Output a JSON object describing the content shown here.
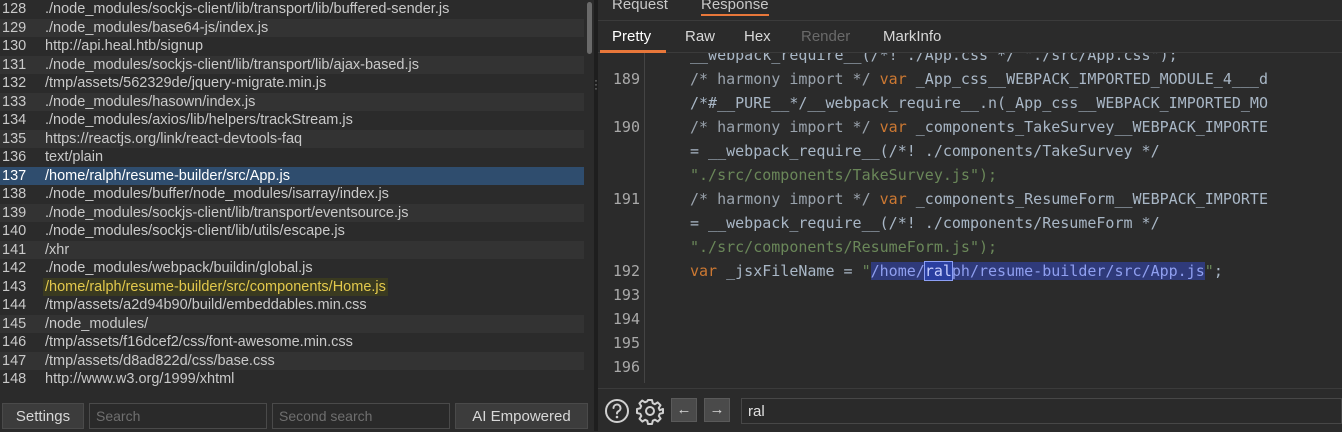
{
  "left_list": {
    "rows": [
      {
        "num": "128",
        "path": "./node_modules/sockjs-client/lib/transport/lib/buffered-sender.js",
        "state": "normal"
      },
      {
        "num": "129",
        "path": "./node_modules/base64-js/index.js",
        "state": "alt"
      },
      {
        "num": "130",
        "path": "http://api.heal.htb/signup",
        "state": "normal"
      },
      {
        "num": "131",
        "path": "./node_modules/sockjs-client/lib/transport/lib/ajax-based.js",
        "state": "alt"
      },
      {
        "num": "132",
        "path": "/tmp/assets/562329de/jquery-migrate.min.js",
        "state": "normal"
      },
      {
        "num": "133",
        "path": "./node_modules/hasown/index.js",
        "state": "alt"
      },
      {
        "num": "134",
        "path": "./node_modules/axios/lib/helpers/trackStream.js",
        "state": "normal"
      },
      {
        "num": "135",
        "path": "https://reactjs.org/link/react-devtools-faq",
        "state": "alt"
      },
      {
        "num": "136",
        "path": "text/plain",
        "state": "normal"
      },
      {
        "num": "137",
        "path": "/home/ralph/resume-builder/src/App.js",
        "state": "selected"
      },
      {
        "num": "138",
        "path": "./node_modules/buffer/node_modules/isarray/index.js",
        "state": "normal"
      },
      {
        "num": "139",
        "path": "./node_modules/sockjs-client/lib/transport/eventsource.js",
        "state": "alt"
      },
      {
        "num": "140",
        "path": "./node_modules/sockjs-client/lib/utils/escape.js",
        "state": "normal"
      },
      {
        "num": "141",
        "path": "/xhr",
        "state": "alt"
      },
      {
        "num": "142",
        "path": "./node_modules/webpack/buildin/global.js",
        "state": "normal"
      },
      {
        "num": "143",
        "path": "/home/ralph/resume-builder/src/components/Home.js",
        "state": "highlight"
      },
      {
        "num": "144",
        "path": "/tmp/assets/a2d94b90/build/embeddables.min.css",
        "state": "normal"
      },
      {
        "num": "145",
        "path": "/node_modules/",
        "state": "alt"
      },
      {
        "num": "146",
        "path": "/tmp/assets/f16dcef2/css/font-awesome.min.css",
        "state": "normal"
      },
      {
        "num": "147",
        "path": "/tmp/assets/d8ad822d/css/base.css",
        "state": "alt"
      },
      {
        "num": "148",
        "path": "http://www.w3.org/1999/xhtml",
        "state": "normal"
      }
    ]
  },
  "left_bottom": {
    "settings_label": "Settings",
    "search_placeholder": "Search",
    "second_search_placeholder": "Second search",
    "ai_label": "AI Empowered"
  },
  "top_tabs": {
    "request": "Request",
    "response": "Response"
  },
  "sub_tabs": {
    "pretty": "Pretty",
    "raw": "Raw",
    "hex": "Hex",
    "render": "Render",
    "markinfo": "MarkInfo"
  },
  "editor": {
    "line_numbers": [
      {
        "n": "189",
        "row": 1
      },
      {
        "n": "190",
        "row": 3
      },
      {
        "n": "191",
        "row": 6
      },
      {
        "n": "192",
        "row": 9
      },
      {
        "n": "193",
        "row": 10
      },
      {
        "n": "194",
        "row": 11
      },
      {
        "n": "195",
        "row": 12
      },
      {
        "n": "196",
        "row": 13
      }
    ],
    "lines": {
      "l0": "__webpack_require__(/*! ./App.css */ \"./src/App.css\");",
      "l1_cmt": "/* harmony import */",
      "l1_kw": "var",
      "l1_rest": " _App_css__WEBPACK_IMPORTED_MODULE_4___d",
      "l2": "/*#__PURE__*/__webpack_require__.n(_App_css__WEBPACK_IMPORTED_MO",
      "l3_cmt": "/* harmony import */",
      "l3_kw": "var",
      "l3_rest": " _components_TakeSurvey__WEBPACK_IMPORTE",
      "l4": "= __webpack_require__(/*! ./components/TakeSurvey */",
      "l5": "\"./src/components/TakeSurvey.js\");",
      "l6_cmt": "/* harmony import */",
      "l6_kw": "var",
      "l6_rest": " _components_ResumeForm__WEBPACK_IMPORTE",
      "l7": "= __webpack_require__(/*! ./components/ResumeForm */",
      "l8": "\"./src/components/ResumeForm.js\");",
      "l9_kw": "var",
      "l9_mid": " _jsxFileName = ",
      "l9_q1": "\"",
      "l9_s1": "/home/",
      "l9_cur": "ral",
      "l9_s2": "ph/resume-builder/src/App.js",
      "l9_q2": "\"",
      "l9_end": ";"
    }
  },
  "search": {
    "value": "ral",
    "help_icon": "question-circle-icon",
    "settings_icon": "gear-icon",
    "prev_icon": "arrow-left-icon",
    "next_icon": "arrow-right-icon"
  }
}
